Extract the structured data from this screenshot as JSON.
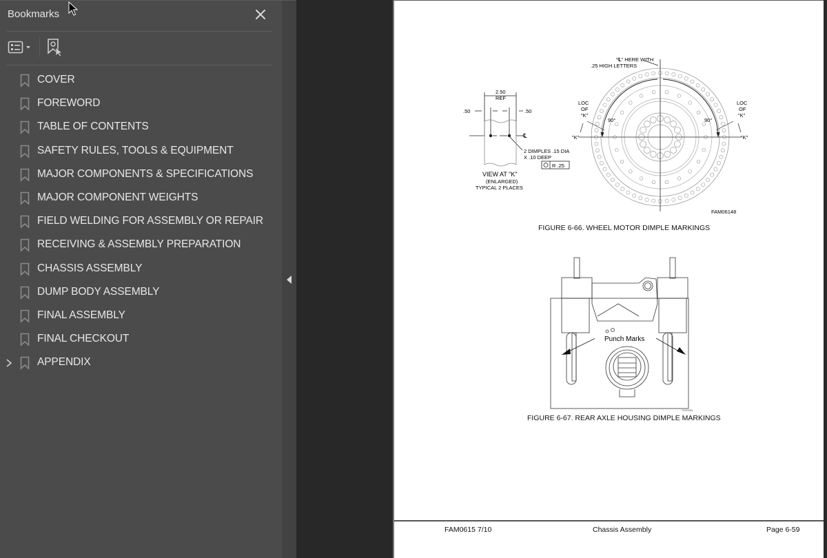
{
  "sidebar": {
    "title": "Bookmarks",
    "close_icon": "close-icon",
    "toolbar": {
      "options_icon": "list-options-icon",
      "new_bookmark_icon": "new-bookmark-icon"
    },
    "items": [
      {
        "label": "COVER",
        "expandable": false
      },
      {
        "label": "FOREWORD",
        "expandable": false
      },
      {
        "label": "TABLE OF CONTENTS",
        "expandable": false
      },
      {
        "label": "SAFETY RULES, TOOLS & EQUIPMENT",
        "expandable": false
      },
      {
        "label": "MAJOR COMPONENTS & SPECIFICATIONS",
        "expandable": false
      },
      {
        "label": "MAJOR COMPONENT WEIGHTS",
        "expandable": false
      },
      {
        "label": "FIELD WELDING FOR ASSEMBLY OR REPAIR",
        "expandable": false
      },
      {
        "label": "RECEIVING & ASSEMBLY PREPARATION",
        "expandable": false
      },
      {
        "label": "CHASSIS ASSEMBLY",
        "expandable": false
      },
      {
        "label": "DUMP BODY ASSEMBLY",
        "expandable": false
      },
      {
        "label": "FINAL ASSEMBLY",
        "expandable": false
      },
      {
        "label": "FINAL CHECKOUT",
        "expandable": false
      },
      {
        "label": "APPENDIX",
        "expandable": true
      }
    ]
  },
  "collapse_handle": {
    "icon": "collapse-left-icon"
  },
  "document": {
    "figure_66": {
      "caption": "FIGURE 6-66. WHEEL MOTOR DIMPLE MARKINGS",
      "drawing_id": "FAM06148",
      "labels": {
        "dim_250": "2.50",
        "dim_ref": "REF",
        "dim_50_left": ".50",
        "dim_50_right": ".50",
        "centerline": "℄",
        "dimples": "2 DIMPLES .15 DIA",
        "deep": "X .10 DEEP",
        "tolerance": "R .25",
        "view": "VIEW AT \"K\"",
        "enlarged": "(ENLARGED)",
        "typical": "TYPICAL 2 PLACES",
        "cl_here": "\"℄\" HERE WITH",
        "letters": ".25 HIGH LETTERS",
        "loc": "LOC",
        "of": "OF",
        "k_quote": "\"K\"",
        "angle": "90°"
      }
    },
    "figure_67": {
      "caption": "FIGURE 6-67. REAR AXLE HOUSING DIMPLE MARKINGS",
      "callout": "Punch Marks",
      "drawing_id": "G050085"
    },
    "footer": {
      "doc_id": "FAM0615  7/10",
      "section": "Chassis Assembly",
      "page": "Page 6-59"
    }
  }
}
